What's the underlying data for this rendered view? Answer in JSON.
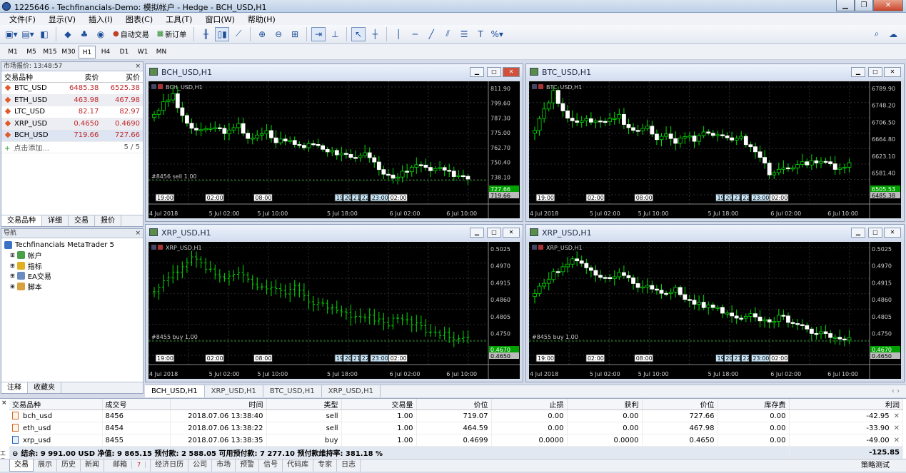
{
  "window": {
    "title": "1225646 - Techfinancials-Demo: 模拟帐户 - Hedge - BCH_USD,H1",
    "minimize": "▁",
    "maximize": "❐",
    "close": "✕"
  },
  "menu": [
    "文件(F)",
    "显示(V)",
    "插入(I)",
    "图表(C)",
    "工具(T)",
    "窗口(W)",
    "帮助(H)"
  ],
  "toolbar": {
    "auto_trading": "自动交易",
    "new_order": "新订单"
  },
  "timeframes": [
    "M1",
    "M5",
    "M15",
    "M30",
    "H1",
    "H4",
    "D1",
    "W1",
    "MN"
  ],
  "active_timeframe": "H1",
  "market_watch": {
    "title": "市场报价: 13:48:57",
    "close": "×",
    "col_symbol": "交易品种",
    "col_bid": "卖价",
    "col_ask": "买价",
    "rows": [
      {
        "symbol": "BTC_USD",
        "bid": "6485.38",
        "ask": "6525.38"
      },
      {
        "symbol": "ETH_USD",
        "bid": "463.98",
        "ask": "467.98"
      },
      {
        "symbol": "LTC_USD",
        "bid": "82.17",
        "ask": "82.97"
      },
      {
        "symbol": "XRP_USD",
        "bid": "0.4650",
        "ask": "0.4690"
      },
      {
        "symbol": "BCH_USD",
        "bid": "719.66",
        "ask": "727.66"
      }
    ],
    "add_label": "点击添加...",
    "count": "5 / 5",
    "tabs": [
      "交易品种",
      "详细",
      "交易",
      "报价"
    ]
  },
  "navigator": {
    "title": "导航",
    "close": "×",
    "root": "Techfinancials MetaTrader 5",
    "items": [
      "帐户",
      "指标",
      "EA交易",
      "脚本"
    ],
    "tabs": [
      "注释",
      "收藏夹"
    ]
  },
  "charts": [
    {
      "title": "BCH_USD,H1",
      "label": "BCH_USD,H1",
      "yticks": [
        "811.90",
        "799.60",
        "787.30",
        "775.00",
        "762.70",
        "750.40",
        "738.10",
        "725.80"
      ],
      "price_tag": "719.66",
      "price_tag2": "727.66",
      "order_line": "#8456 sell 1.00",
      "time_top": [
        "19:00",
        "02:00",
        "08:00",
        "19",
        "20",
        "21",
        "22",
        "23:00",
        "02:00"
      ],
      "xticks": [
        "4 Jul 2018",
        "5 Jul 02:00",
        "5 Jul 10:00",
        "5 Jul 18:00",
        "6 Jul 02:00",
        "6 Jul 10:00"
      ]
    },
    {
      "title": "BTC_USD,H1",
      "label": "BTC_USD,H1",
      "yticks": [
        "6789.90",
        "6748.20",
        "6706.50",
        "6664.80",
        "6623.10",
        "6581.40",
        "6539.70"
      ],
      "price_tag": "6485.38",
      "price_tag2": "6505.53",
      "order_line": "",
      "time_top": [
        "19:00",
        "02:00",
        "08:00",
        "19",
        "20",
        "21",
        "22",
        "23:00",
        "02:00"
      ],
      "xticks": [
        "4 Jul 2018",
        "5 Jul 02:00",
        "5 Jul 10:00",
        "5 Jul 18:00",
        "6 Jul 02:00",
        "6 Jul 10:00"
      ]
    },
    {
      "title": "XRP_USD,H1",
      "label": "XRP_USD,H1",
      "yticks": [
        "0.5025",
        "0.4970",
        "0.4915",
        "0.4860",
        "0.4805",
        "0.4750",
        "0.4695"
      ],
      "price_tag": "0.4650",
      "price_tag2": "0.4670",
      "order_line": "#8455 buy 1.00",
      "time_top": [
        "19:00",
        "02:00",
        "08:00",
        "19",
        "20",
        "21",
        "22",
        "23:00",
        "02:00"
      ],
      "xticks": [
        "4 Jul 2018",
        "5 Jul 02:00",
        "5 Jul 10:00",
        "5 Jul 18:00",
        "6 Jul 02:00",
        "6 Jul 10:00"
      ]
    },
    {
      "title": "XRP_USD,H1",
      "label": "XRP_USD,H1",
      "yticks": [
        "0.5025",
        "0.4970",
        "0.4915",
        "0.4860",
        "0.4805",
        "0.4750",
        "0.4695"
      ],
      "price_tag": "0.4650",
      "price_tag2": "0.4670",
      "order_line": "#8455 buy 1.00",
      "time_top": [
        "19:00",
        "02:00",
        "08:00",
        "19",
        "20",
        "21",
        "22",
        "23:00",
        "02:00"
      ],
      "xticks": [
        "4 Jul 2018",
        "5 Jul 02:00",
        "5 Jul 10:00",
        "5 Jul 18:00",
        "6 Jul 02:00",
        "6 Jul 10:00"
      ]
    }
  ],
  "chart_tabs": [
    "BCH_USD,H1",
    "XRP_USD,H1",
    "BTC_USD,H1",
    "XRP_USD,H1"
  ],
  "terminal": {
    "headers": [
      "交易品种",
      "成交号",
      "时间",
      "类型",
      "交易量",
      "价位",
      "止损",
      "获利",
      "价位",
      "库存费",
      "利润"
    ],
    "rows": [
      {
        "symbol": "bch_usd",
        "deal": "8456",
        "time": "2018.07.06 13:38:40",
        "type": "sell",
        "volume": "1.00",
        "price": "719.07",
        "sl": "0.00",
        "tp": "0.00",
        "cur": "727.66",
        "swap": "0.00",
        "profit": "-42.95"
      },
      {
        "symbol": "eth_usd",
        "deal": "8454",
        "time": "2018.07.06 13:38:22",
        "type": "sell",
        "volume": "1.00",
        "price": "464.59",
        "sl": "0.00",
        "tp": "0.00",
        "cur": "467.98",
        "swap": "0.00",
        "profit": "-33.90"
      },
      {
        "symbol": "xrp_usd",
        "deal": "8455",
        "time": "2018.07.06 13:38:35",
        "type": "buy",
        "volume": "1.00",
        "price": "0.4699",
        "sl": "0.0000",
        "tp": "0.0000",
        "cur": "0.4650",
        "swap": "0.00",
        "profit": "-49.00"
      }
    ],
    "summary": "结余: 9 991.00 USD  净值: 9 865.15  预付款: 2 588.05  可用预付款: 7 277.10  预付款维持率: 381.18 %",
    "total": "-125.85",
    "side_label": "工具箱"
  },
  "bottom_tabs": [
    "交易",
    "展示",
    "历史",
    "新闻",
    "邮箱",
    "经济日历",
    "公司",
    "市场",
    "预警",
    "信号",
    "代码库",
    "专家",
    "日志"
  ],
  "mail_count": "7",
  "mode": "策略测试",
  "colors": {
    "bull": "#ffffff",
    "bear": "#ffffff",
    "line_chart": "#00e000",
    "grid": "#3a3a3a",
    "bid_tag": "#00b000"
  }
}
